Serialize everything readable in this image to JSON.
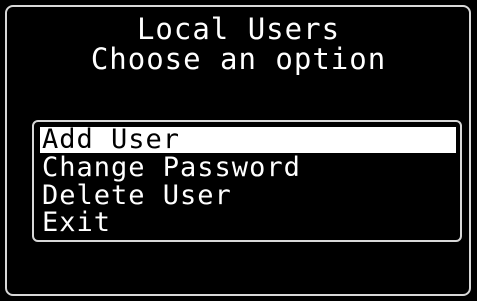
{
  "screen": {
    "title_line_1": "Local Users",
    "title_line_2": "Choose an option"
  },
  "menu": {
    "selected_index": 0,
    "items": [
      {
        "label": "Add User"
      },
      {
        "label": "Change Password"
      },
      {
        "label": "Delete User"
      },
      {
        "label": "Exit"
      }
    ]
  },
  "colors": {
    "background": "#000000",
    "foreground": "#ffffff",
    "frame": "#d8d8d8",
    "highlight": "#ffffff"
  }
}
